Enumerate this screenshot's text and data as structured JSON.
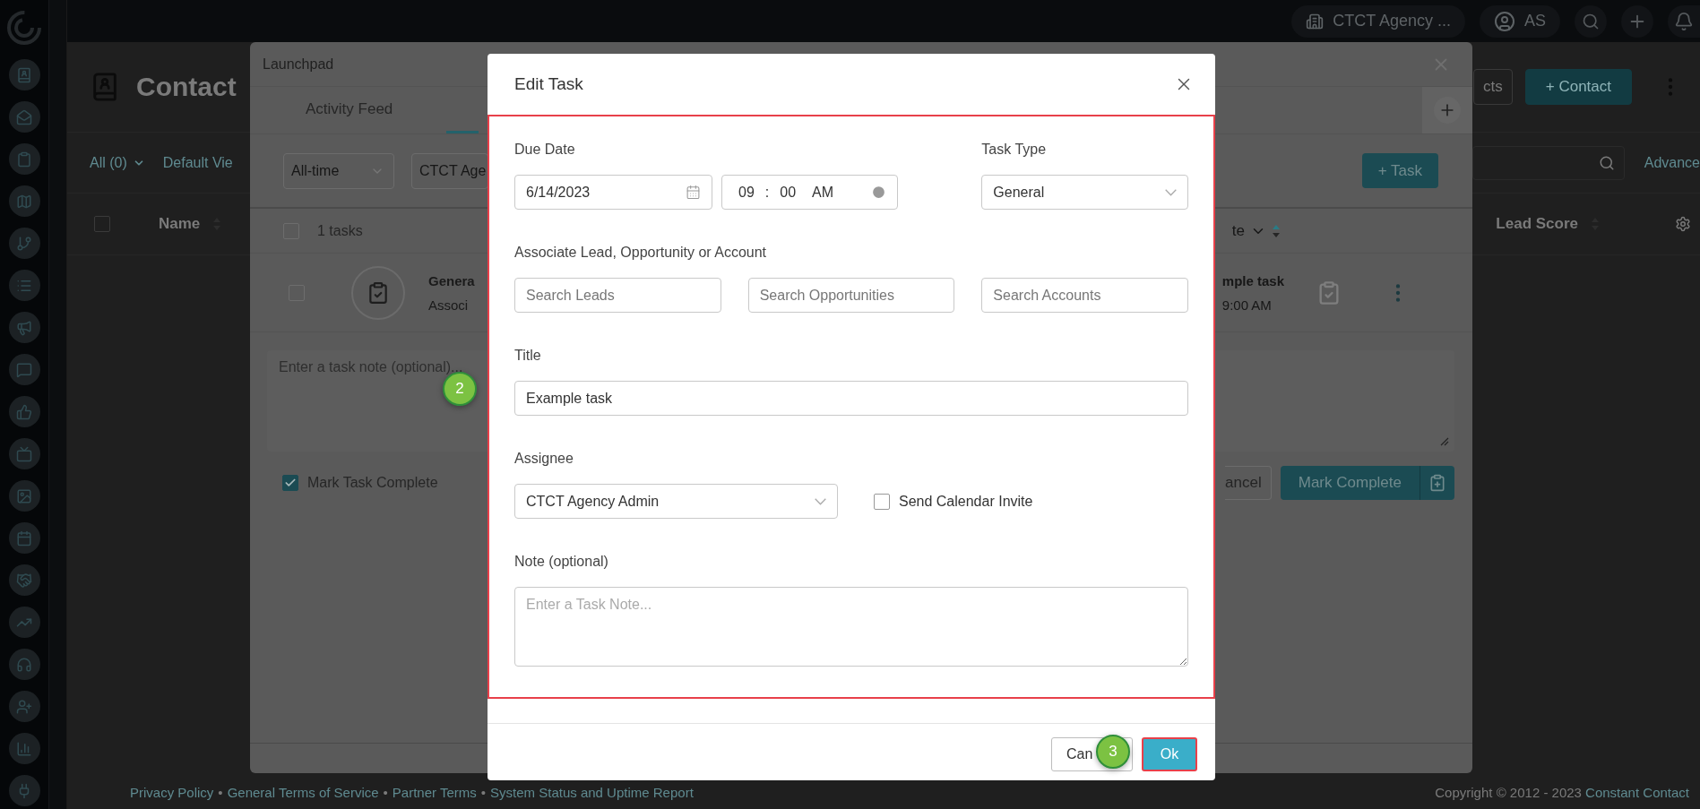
{
  "topbar": {
    "account": "CTCT Agency ...",
    "user_initials": "AS"
  },
  "page": {
    "title": "Contact",
    "filter": "All (0)",
    "view": "Default Vie",
    "buttons": [
      {
        "label": "cts",
        "kind": "secondary"
      },
      {
        "label": "+ Contact",
        "kind": "primary"
      }
    ],
    "advanced_link": "Advance",
    "select_all_checked": false,
    "columns": [
      {
        "label": "Name"
      },
      {
        "label": "Lead Score"
      }
    ]
  },
  "launchpad": {
    "title": "Launchpad",
    "tabs": [
      {
        "label": "Activity Feed",
        "selected": false
      },
      {
        "selected": true
      }
    ],
    "filters": [
      {
        "value": "All-time"
      },
      {
        "value": "CTCT Age"
      }
    ],
    "add_task": "+ Task",
    "select_all_checked": false,
    "task_count": "1 tasks",
    "sort_column": "te",
    "task": {
      "type": "Genera",
      "association": "Associ",
      "title": "mple task",
      "due": "9:00 AM",
      "checked": false
    },
    "note_placeholder": "Enter a task note (optional)...",
    "mark_complete": {
      "label": "Mark Task Complete",
      "checked": true
    },
    "cancel": "ancel",
    "complete_button": "Mark Complete"
  },
  "footer": {
    "links": [
      "Privacy Policy",
      "General Terms of Service",
      "Partner Terms",
      "System Status and Uptime Report"
    ],
    "separator": "•",
    "copyright": "Copyright © 2012 - 2023",
    "company": "Constant Contact"
  },
  "dialog": {
    "title": "Edit Task",
    "form_highlighted": true,
    "due_date": {
      "label": "Due Date",
      "date": "6/14/2023",
      "hour": "09",
      "separator": ":",
      "minute": "00",
      "period": "AM"
    },
    "task_type": {
      "label": "Task Type",
      "value": "General"
    },
    "associate": {
      "label": "Associate Lead, Opportunity or Account",
      "fields": [
        {
          "placeholder": "Search Leads"
        },
        {
          "placeholder": "Search Opportunities"
        },
        {
          "placeholder": "Search Accounts"
        }
      ]
    },
    "title_field": {
      "label": "Title",
      "value": "Example task"
    },
    "assignee": {
      "label": "Assignee",
      "value": "CTCT Agency Admin"
    },
    "calendar_invite": {
      "label": "Send Calendar Invite",
      "checked": false
    },
    "note": {
      "label": "Note (optional)",
      "placeholder": "Enter a Task Note..."
    },
    "buttons": [
      {
        "label": "Can",
        "kind": "secondary",
        "highlighted": false
      },
      {
        "label": "Ok",
        "kind": "primary",
        "highlighted": true
      }
    ]
  },
  "callouts": [
    {
      "number": "2"
    },
    {
      "number": "3"
    }
  ]
}
